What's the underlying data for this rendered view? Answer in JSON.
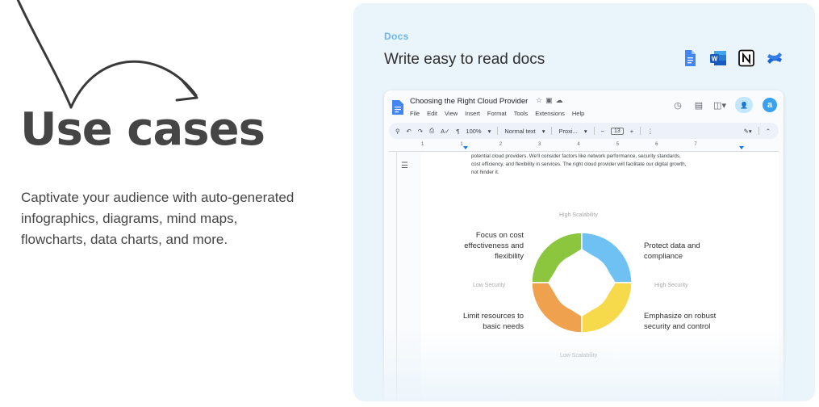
{
  "hero": {
    "title": "Use cases",
    "description": "Captivate your audience with auto-generated infographics, diagrams, mind maps, flowcharts, data charts, and more."
  },
  "card": {
    "kicker": "Docs",
    "title": "Write easy to read docs",
    "integrations": [
      "google-docs-icon",
      "microsoft-word-icon",
      "notion-icon",
      "confluence-icon"
    ]
  },
  "doc": {
    "name": "Choosing the Right Cloud Provider",
    "menu": [
      "File",
      "Edit",
      "View",
      "Insert",
      "Format",
      "Tools",
      "Extensions",
      "Help"
    ],
    "avatar_letter": "a",
    "toolbar": {
      "zoom": "100%",
      "style": "Normal text",
      "font": "Proxi...",
      "font_size": "13"
    },
    "ruler_numbers": [
      "1",
      "1",
      "2",
      "3",
      "4",
      "5",
      "6",
      "7"
    ],
    "paragraph": "potential cloud providers. We'll consider factors like network performance, security standards, cost efficiency, and flexibility in services. The right cloud provider will facilitate our digital growth, not hinder it."
  },
  "diagram": {
    "axis_top": "High Scalability",
    "axis_bottom": "Low Scalability",
    "axis_left": "Low Security",
    "axis_right": "High Security",
    "quadrant_top_left": "Focus on cost effectiveness and flexibility",
    "quadrant_top_right": "Protect data and compliance",
    "quadrant_bottom_left": "Limit resources to basic needs",
    "quadrant_bottom_right": "Emphasize on robust security and control",
    "colors": {
      "top_left": "#8cc63f",
      "top_right": "#6ec1f2",
      "bottom_left": "#f0a14e",
      "bottom_right": "#f7d94c"
    }
  }
}
